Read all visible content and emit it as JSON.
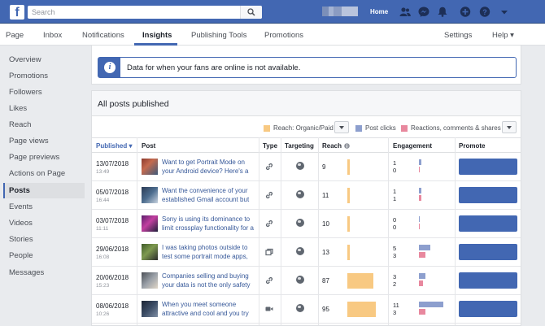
{
  "topbar": {
    "logo": "f",
    "search_placeholder": "Search",
    "home_label": "Home",
    "icons": [
      "friends-icon",
      "messenger-icon",
      "notifications-icon",
      "create-icon",
      "help-icon",
      "account-menu-icon"
    ]
  },
  "pagenav": {
    "items": [
      {
        "label": "Page"
      },
      {
        "label": "Inbox"
      },
      {
        "label": "Notifications"
      },
      {
        "label": "Insights"
      },
      {
        "label": "Publishing Tools"
      },
      {
        "label": "Promotions"
      },
      {
        "label": "Settings"
      },
      {
        "label": "Help ▾"
      }
    ],
    "active": "Insights"
  },
  "sidebar": {
    "items": [
      {
        "label": "Overview"
      },
      {
        "label": "Promotions"
      },
      {
        "label": "Followers"
      },
      {
        "label": "Likes"
      },
      {
        "label": "Reach"
      },
      {
        "label": "Page views"
      },
      {
        "label": "Page previews"
      },
      {
        "label": "Actions on Page"
      },
      {
        "label": "Posts"
      },
      {
        "label": "Events"
      },
      {
        "label": "Videos"
      },
      {
        "label": "Stories"
      },
      {
        "label": "People"
      },
      {
        "label": "Messages"
      }
    ],
    "active": "Posts"
  },
  "info": {
    "message": "Data for when your fans are online is not available."
  },
  "posts": {
    "title": "All posts published",
    "legend": {
      "reach": "Reach: Organic/Paid",
      "clicks": "Post clicks",
      "reactions": "Reactions, comments & shares"
    },
    "columns": {
      "published": "Published ▾",
      "post": "Post",
      "type": "Type",
      "targeting": "Targeting",
      "reach": "Reach",
      "engagement": "Engagement",
      "promote": "Promote"
    },
    "reach_max": 95,
    "engagement_max": 11,
    "rows": [
      {
        "date": "13/07/2018",
        "time": "13:49",
        "text": "Want to get Portrait Mode on your Android device? Here's a guide",
        "type": "link",
        "reach": "9",
        "reach_value": 9,
        "clicks": "1",
        "clicks_value": 1,
        "reactions": "0",
        "reactions_value": 0
      },
      {
        "date": "05/07/2018",
        "time": "16:44",
        "text": "Want the convenience of your established Gmail account but also",
        "type": "link",
        "reach": "11",
        "reach_value": 11,
        "clicks": "1",
        "clicks_value": 1,
        "reactions": "1",
        "reactions_value": 1
      },
      {
        "date": "03/07/2018",
        "time": "11:11",
        "text": "Sony is using its dominance to limit crossplay functionality for a",
        "type": "link",
        "reach": "10",
        "reach_value": 10,
        "clicks": "0",
        "clicks_value": 0,
        "reactions": "0",
        "reactions_value": 0
      },
      {
        "date": "29/06/2018",
        "time": "16:08",
        "text": "I was taking photos outside to test some portrait mode apps, kno",
        "type": "album",
        "reach": "13",
        "reach_value": 13,
        "clicks": "5",
        "clicks_value": 5,
        "reactions": "3",
        "reactions_value": 3
      },
      {
        "date": "20/06/2018",
        "time": "15:23",
        "text": "Companies selling and buying your data is not the only safety con",
        "type": "link",
        "reach": "87",
        "reach_value": 87,
        "clicks": "3",
        "clicks_value": 3,
        "reactions": "2",
        "reactions_value": 2
      },
      {
        "date": "08/06/2018",
        "time": "10:26",
        "text": "When you meet someone attractive and cool and you try to be su",
        "type": "video",
        "reach": "95",
        "reach_value": 95,
        "clicks": "11",
        "clicks_value": 11,
        "reactions": "3",
        "reactions_value": 3
      }
    ]
  },
  "colors": {
    "brand": "#4267b2",
    "reach_bar": "#f8c982",
    "clicks_bar": "#8d9fce",
    "reactions_bar": "#e8889e"
  }
}
